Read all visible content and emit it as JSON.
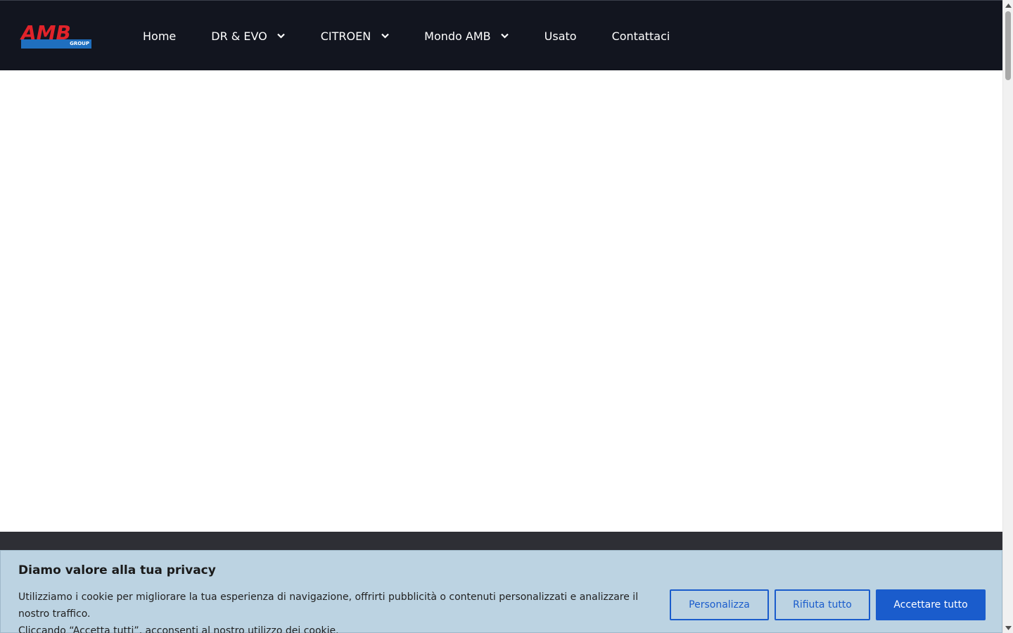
{
  "header": {
    "logo": {
      "text": "AMB",
      "sub": "GROUP",
      "colors": {
        "red": "#e1232a",
        "blue": "#1f6fbf"
      }
    },
    "nav": [
      {
        "label": "Home",
        "dropdown": false
      },
      {
        "label": "DR & EVO",
        "dropdown": true
      },
      {
        "label": "CITROEN",
        "dropdown": true
      },
      {
        "label": "Mondo AMB",
        "dropdown": true
      },
      {
        "label": "Usato",
        "dropdown": false
      },
      {
        "label": "Contattaci",
        "dropdown": false
      }
    ]
  },
  "cookie_banner": {
    "title": "Diamo valore alla tua privacy",
    "text_line1": "Utilizziamo i cookie per migliorare la tua esperienza di navigazione, offrirti pubblicità o contenuti personalizzati e analizzare il nostro traffico.",
    "text_line2": "Cliccando “Accetta tutti”, acconsenti al nostro utilizzo dei cookie.",
    "buttons": {
      "customize": "Personalizza",
      "reject": "Rifiuta tutto",
      "accept": "Accettare tutto"
    },
    "colors": {
      "background": "#bcd3e2",
      "primary": "#1a5ccc"
    }
  },
  "colors": {
    "header_bg": "#12151f",
    "footer_bg": "#2e2f35"
  }
}
